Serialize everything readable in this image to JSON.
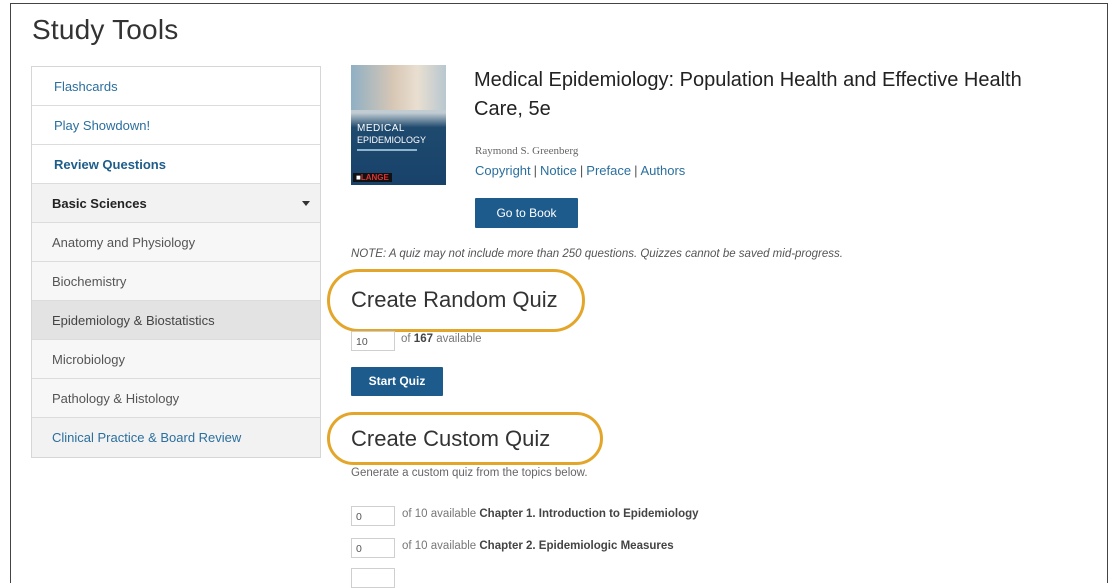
{
  "page_title": "Study Tools",
  "sidebar": {
    "items": [
      {
        "label": "Flashcards"
      },
      {
        "label": "Play Showdown!"
      },
      {
        "label": "Review Questions"
      },
      {
        "label": "Basic Sciences"
      },
      {
        "label": "Anatomy and Physiology"
      },
      {
        "label": "Biochemistry"
      },
      {
        "label": "Epidemiology & Biostatistics"
      },
      {
        "label": "Microbiology"
      },
      {
        "label": "Pathology & Histology"
      },
      {
        "label": "Clinical Practice & Board Review"
      }
    ]
  },
  "book": {
    "title": "Medical Epidemiology: Population Health and Effective Health Care, 5e",
    "author": "Raymond S. Greenberg",
    "cover_title_1": "MEDICAL",
    "cover_title_2": "EPIDEMIOLOGY",
    "cover_publisher": "LANGE",
    "links": [
      "Copyright",
      "Notice",
      "Preface",
      "Authors"
    ],
    "go_button": "Go to Book"
  },
  "note": "NOTE: A quiz may not include more than 250 questions. Quizzes cannot be saved mid-progress.",
  "random_quiz": {
    "title": "Create Random Quiz",
    "count_value": "10",
    "available_prefix": "of",
    "available_count": "167",
    "available_suffix": "available",
    "start_button": "Start Quiz"
  },
  "custom_quiz": {
    "title": "Create Custom Quiz",
    "description": "Generate a custom quiz from the topics below.",
    "chapters": [
      {
        "value": "0",
        "available_text": "of 10 available",
        "chapter": "Chapter 1. Introduction to Epidemiology"
      },
      {
        "value": "0",
        "available_text": "of 10 available",
        "chapter": "Chapter 2. Epidemiologic Measures"
      }
    ]
  },
  "colors": {
    "accent": "#1c5b8c",
    "link": "#2a6f9e",
    "highlight": "#e3a62a"
  }
}
